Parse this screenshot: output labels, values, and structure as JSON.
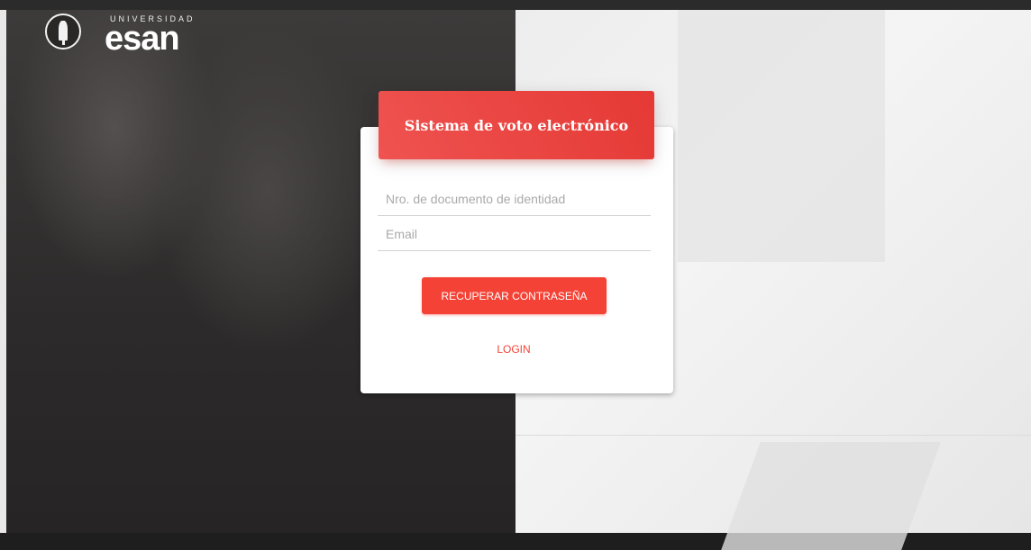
{
  "brand": {
    "university": "UNIVERSIDAD",
    "name": "esan"
  },
  "card": {
    "title": "Sistema de voto electrónico"
  },
  "form": {
    "document_placeholder": "Nro. de documento de identidad",
    "email_placeholder": "Email",
    "recover_label": "RECUPERAR CONTRASEÑA",
    "login_label": "LOGIN"
  },
  "colors": {
    "accent": "#f44336",
    "header_gradient_start": "#ef5350",
    "header_gradient_end": "#e53935"
  }
}
